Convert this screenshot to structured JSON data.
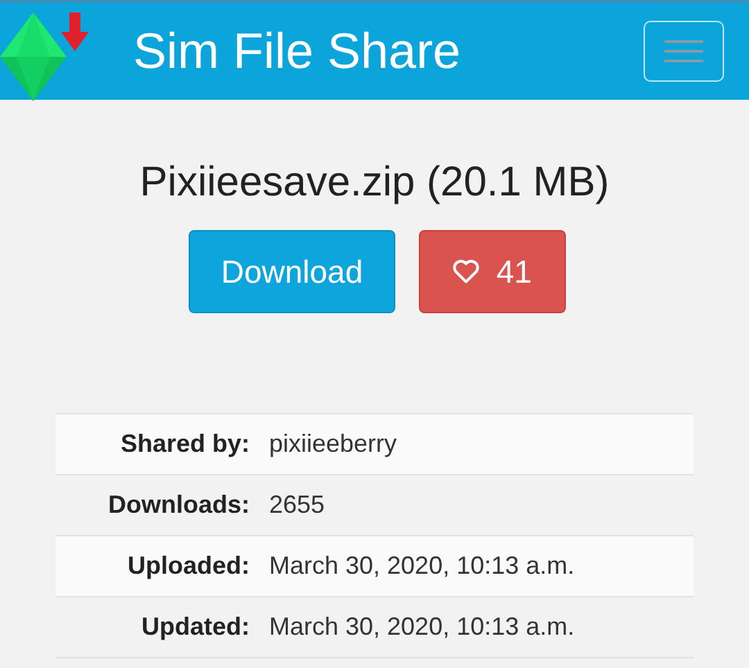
{
  "header": {
    "title": "Sim File Share"
  },
  "file": {
    "title": "Pixiieesave.zip (20.1 MB)"
  },
  "buttons": [
    {
      "kind": "download",
      "label": "Download"
    },
    {
      "kind": "like",
      "label": "41"
    }
  ],
  "details": [
    {
      "label": "Shared by:",
      "value": "pixiieeberry"
    },
    {
      "label": "Downloads:",
      "value": "2655"
    },
    {
      "label": "Uploaded:",
      "value": "March 30, 2020, 10:13 a.m."
    },
    {
      "label": "Updated:",
      "value": "March 30, 2020, 10:13 a.m."
    }
  ]
}
